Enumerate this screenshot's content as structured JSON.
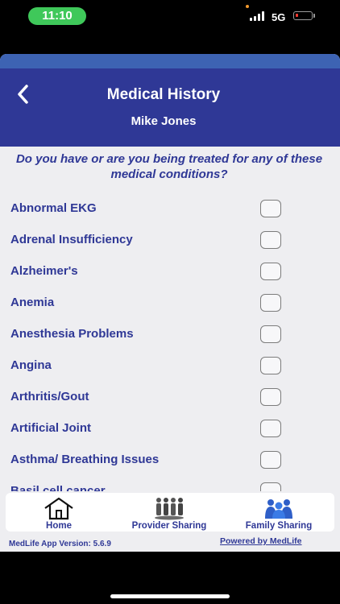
{
  "status_bar": {
    "time": "11:10",
    "network": "5G"
  },
  "header": {
    "back_icon": "chevron-left-icon",
    "title": "Medical History",
    "patient_name": "Mike Jones"
  },
  "question": "Do you have or are you being treated for any of these medical conditions?",
  "conditions": [
    {
      "label": "Abnormal EKG",
      "checked": false
    },
    {
      "label": "Adrenal Insufficiency",
      "checked": false
    },
    {
      "label": "Alzheimer's",
      "checked": false
    },
    {
      "label": "Anemia",
      "checked": false
    },
    {
      "label": "Anesthesia Problems",
      "checked": false
    },
    {
      "label": "Angina",
      "checked": false
    },
    {
      "label": "Arthritis/Gout",
      "checked": false
    },
    {
      "label": "Artificial Joint",
      "checked": false
    },
    {
      "label": "Asthma/ Breathing Issues",
      "checked": false
    },
    {
      "label": "Basil cell cancer",
      "checked": false
    }
  ],
  "tabs": [
    {
      "label": "Home",
      "icon": "home-icon"
    },
    {
      "label": "Provider Sharing",
      "icon": "provider-sharing-icon"
    },
    {
      "label": "Family Sharing",
      "icon": "family-sharing-icon"
    }
  ],
  "footer": {
    "version": "MedLife App Version: 5.6.9",
    "powered_by": "Powered by MedLife"
  },
  "colors": {
    "primary": "#2f3896",
    "header_strip": "#3d63b3",
    "time_pill": "#3fc85a",
    "battery_low": "#ff3b30"
  }
}
